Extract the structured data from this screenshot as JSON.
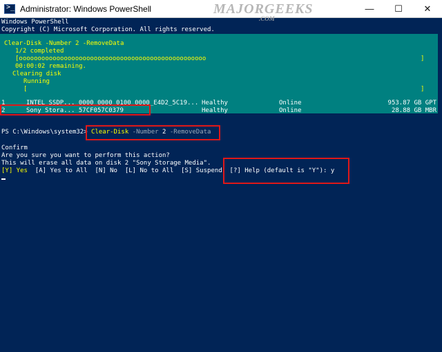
{
  "window": {
    "title": "Administrator: Windows PowerShell",
    "minimize_icon": "minimize-icon",
    "maximize_icon": "maximize-icon",
    "close_icon": "close-icon"
  },
  "watermark": {
    "text": "MAJORGEEKS",
    "sub": ".COM"
  },
  "console": {
    "header_line1": "Windows PowerShell",
    "header_line2": "Copyright (C) Microsoft Corporation. All rights reserved.",
    "progress": {
      "activity": "Clear-Disk -Number 2 -RemoveData",
      "status1": "1/2 completed",
      "bar1": "[oooooooooooooooooooooooooooooooooooooooooooooooooo",
      "bar1_end": "]",
      "remaining": "00:00:02 remaining.",
      "activity2": "Clearing disk",
      "status2": "Running",
      "bar2": "[",
      "bar2_end": "]"
    },
    "disks": [
      {
        "number": "1",
        "name": "INTEL SSDP... 0000_0000_0100_0000_E4D2_5C19...",
        "health": "Healthy",
        "status": "Online",
        "size": "953.87 GB GPT"
      },
      {
        "number": "2",
        "name": "Sony Stora... 57CF057C0379",
        "health": "Healthy",
        "status": "Online",
        "size": "28.88 GB MBR"
      }
    ],
    "prompt": "PS C:\\Windows\\system32>",
    "command": "Clear-Disk",
    "param1": "-Number",
    "arg1": "2",
    "param2": "-RemoveData",
    "confirm_title": "Confirm",
    "confirm_q": "Are you sure you want to perform this action?",
    "confirm_detail": "This will erase all data on disk 2 \"Sony Storage Media\".",
    "option_yes": "[Y] Yes",
    "options_rest": "  [A] Yes to All  [N] No  [L] No to All  [S] Suspend  ",
    "help_answer": "[?] Help (default is \"Y\"): y"
  },
  "colors": {
    "background": "#012456",
    "progress_bg": "#008080",
    "highlight": "#ffff00",
    "annotation_box": "#e01818"
  }
}
